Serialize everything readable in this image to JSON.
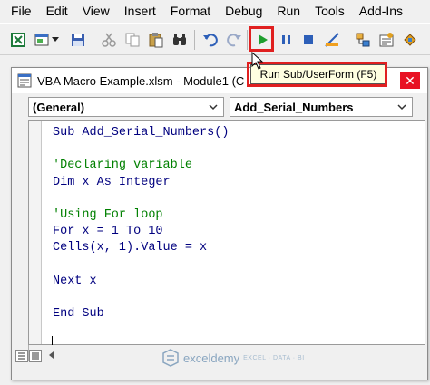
{
  "menu": [
    "File",
    "Edit",
    "View",
    "Insert",
    "Format",
    "Debug",
    "Run",
    "Tools",
    "Add-Ins"
  ],
  "toolbar": {
    "icons": [
      "excel-icon",
      "insert-module-icon",
      "save-icon",
      "cut-icon",
      "copy-icon",
      "paste-icon",
      "find-icon",
      "undo-icon",
      "redo-icon",
      "run-icon",
      "break-icon",
      "reset-icon",
      "design-mode-icon",
      "project-explorer-icon",
      "properties-icon",
      "object-browser-icon"
    ]
  },
  "tooltip": "Run Sub/UserForm (F5)",
  "window": {
    "title": "VBA Macro Example.xlsm - Module1 (C",
    "close_label": "✕"
  },
  "dropdowns": {
    "object": "(General)",
    "procedure": "Add_Serial_Numbers"
  },
  "code_lines": [
    [
      {
        "t": "kw",
        "s": "Sub Add_Serial_Numbers()"
      }
    ],
    [
      {
        "t": "tx",
        "s": ""
      }
    ],
    [
      {
        "t": "cm",
        "s": "'Declaring variable"
      }
    ],
    [
      {
        "t": "kw",
        "s": "Dim x As Integer"
      }
    ],
    [
      {
        "t": "tx",
        "s": ""
      }
    ],
    [
      {
        "t": "cm",
        "s": "'Using For loop"
      }
    ],
    [
      {
        "t": "kw",
        "s": "For x = 1 To 10"
      }
    ],
    [
      {
        "t": "kw",
        "s": "Cells(x, 1).Value = x"
      }
    ],
    [
      {
        "t": "tx",
        "s": ""
      }
    ],
    [
      {
        "t": "kw",
        "s": "Next x"
      }
    ],
    [
      {
        "t": "tx",
        "s": ""
      }
    ],
    [
      {
        "t": "kw",
        "s": "End Sub"
      }
    ]
  ],
  "watermark": {
    "name": "exceldemy",
    "tagline": "EXCEL · DATA · BI"
  },
  "colors": {
    "keyword": "#00007f",
    "comment": "#008000",
    "highlight": "#e02020",
    "run": "#1e9e2e",
    "close": "#e81123"
  }
}
